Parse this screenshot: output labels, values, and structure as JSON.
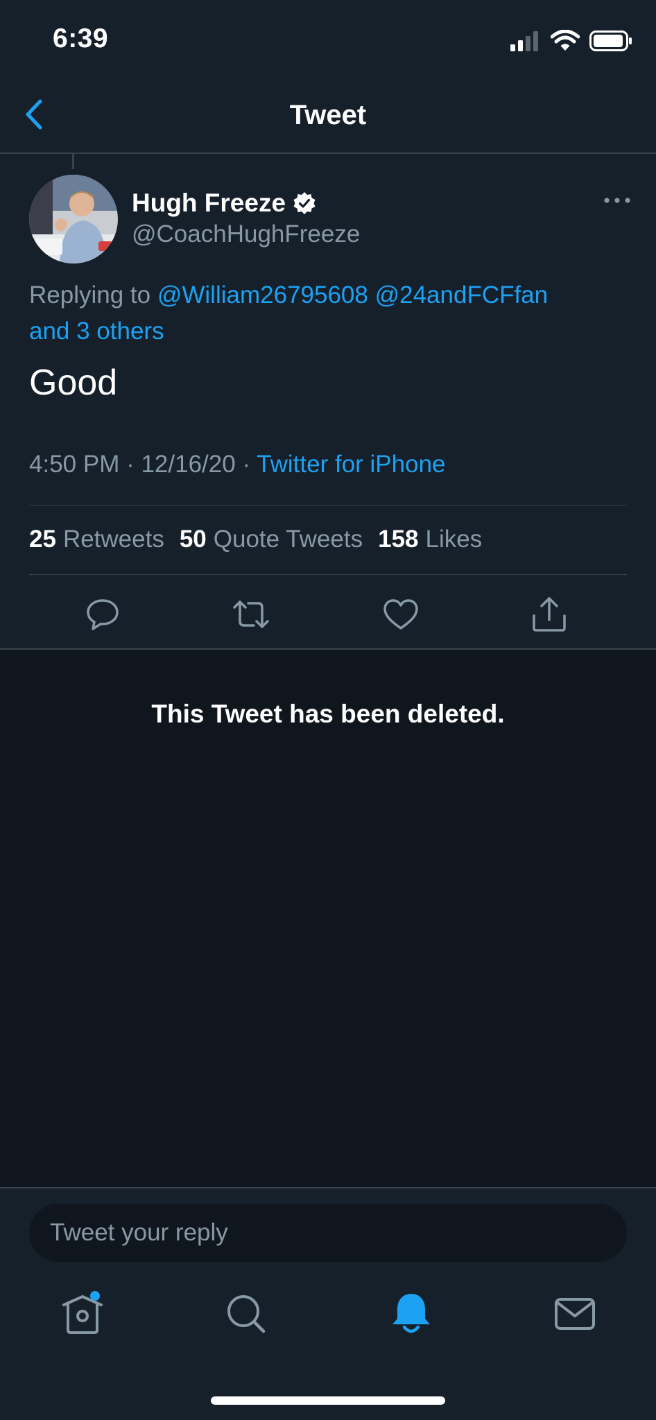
{
  "status_bar": {
    "time": "6:39",
    "signal_bars": 4,
    "signal_bars_filled": 2,
    "battery_level": 0.85
  },
  "nav": {
    "title": "Tweet",
    "back_icon": "chevron-left-icon"
  },
  "tweet": {
    "author_name": "Hugh Freeze",
    "author_handle": "@CoachHughFreeze",
    "verified_icon": "verified-badge-icon",
    "more_icon": "more-horizontal-icon",
    "replying_prefix": "Replying to",
    "replying_user_1": "@William26795608",
    "replying_user_2": "@24andFCFfan",
    "replying_others": "and 3 others",
    "text": "Good",
    "timestamp": "4:50 PM · 12/16/20 ·",
    "source": "Twitter for iPhone",
    "stats": {
      "retweets_count": "25",
      "retweets_label": "Retweets",
      "quotes_count": "50",
      "quotes_label": "Quote Tweets",
      "likes_count": "158",
      "likes_label": "Likes"
    },
    "actions": [
      "reply-icon",
      "retweet-icon",
      "like-icon",
      "share-icon"
    ]
  },
  "deleted_notice": "This Tweet has been deleted.",
  "reply": {
    "placeholder": "Tweet your reply"
  },
  "tab_bar": {
    "tabs": [
      "home-icon",
      "search-icon",
      "notifications-icon",
      "messages-icon"
    ],
    "active": "notifications-icon",
    "home_has_new": true
  },
  "colors": {
    "background": "#15202b",
    "accent": "#1da1f2",
    "secondary_text": "#8899a6",
    "divider": "#38444d"
  }
}
